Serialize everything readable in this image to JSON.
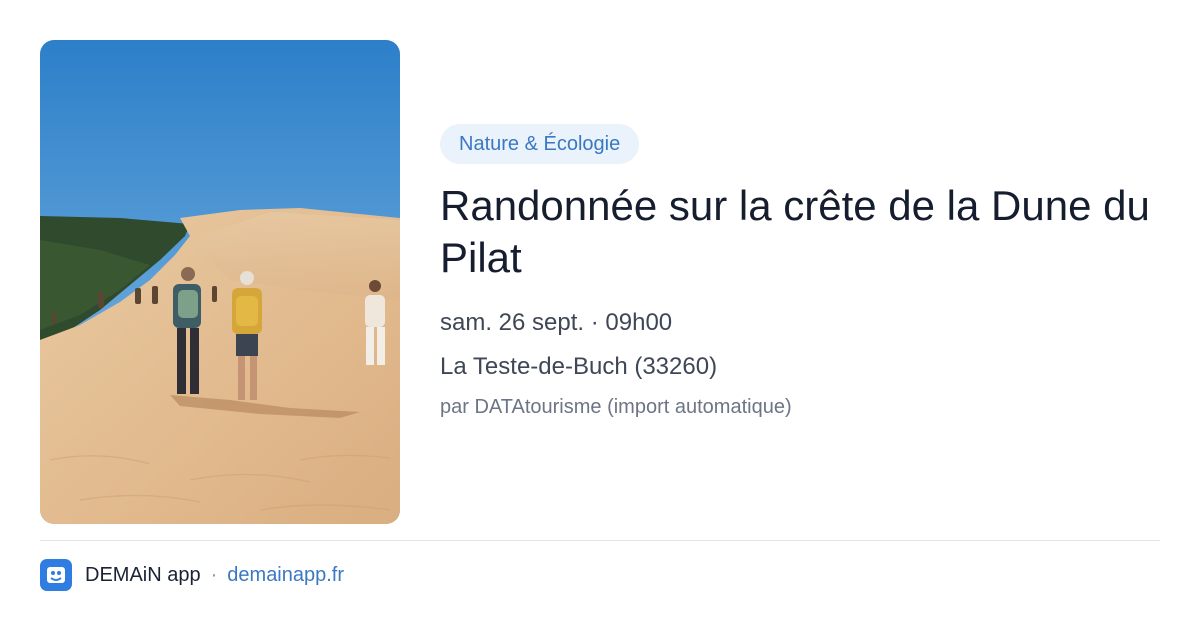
{
  "photo": {
    "alt_icon": "dune-hikers-photo"
  },
  "event": {
    "category": "Nature & Écologie",
    "title": "Randonnée sur la crête de la Dune du Pilat",
    "date_time": "sam. 26 sept. · 09h00",
    "location": "La Teste-de-Buch (33260)",
    "source": "par DATAtourisme (import automatique)"
  },
  "footer": {
    "app_name": "DEMAiN app",
    "separator": "·",
    "link": "demainapp.fr",
    "logo_icon": "demain-app-logo-icon"
  },
  "colors": {
    "accent": "#3b78c3",
    "chip_bg": "#eaf2fc",
    "title": "#151d2e",
    "muted": "#6c7585"
  }
}
